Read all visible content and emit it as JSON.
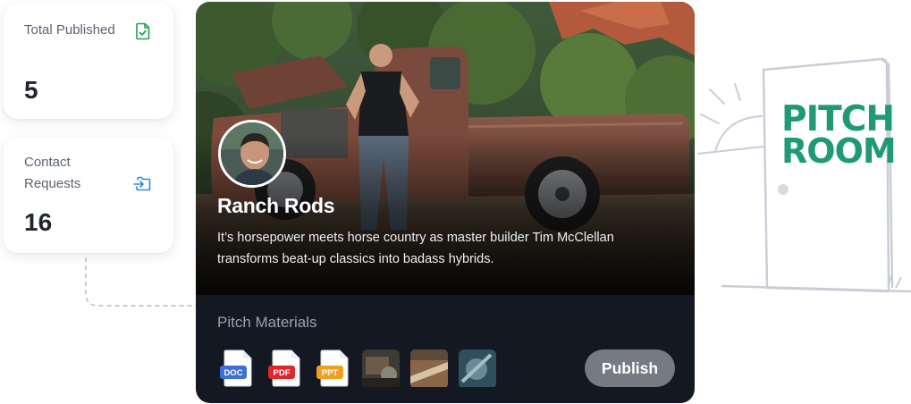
{
  "stats": {
    "published": {
      "label": "Total Published",
      "value": "5",
      "icon": "file-check-icon",
      "icon_color": "#20a05a"
    },
    "contacts": {
      "label": "Contact Requests",
      "value": "16",
      "icon": "folder-login-icon",
      "icon_color": "#2b8fd6"
    }
  },
  "show": {
    "title": "Ranch Rods",
    "description": "It’s horsepower meets horse country as master builder Tim McClellan transforms beat-up classics into badass hybrids.",
    "hero_image": "rusty-pickup-truck-with-host-photo",
    "avatar_image": "host-portrait"
  },
  "materials": {
    "label": "Pitch Materials",
    "files": [
      {
        "type": "DOC",
        "color": "#3d6fd8"
      },
      {
        "type": "PDF",
        "color": "#e0262b"
      },
      {
        "type": "PPT",
        "color": "#f0a020"
      }
    ],
    "thumbnails": [
      "engine-thumbnail",
      "truck-detail-thumbnail",
      "machinery-thumbnail"
    ]
  },
  "actions": {
    "publish_label": "Publish"
  },
  "illustration": {
    "sign_text_line1": "PITCH",
    "sign_text_line2": "ROOM",
    "sign_color": "#1f9a74"
  }
}
